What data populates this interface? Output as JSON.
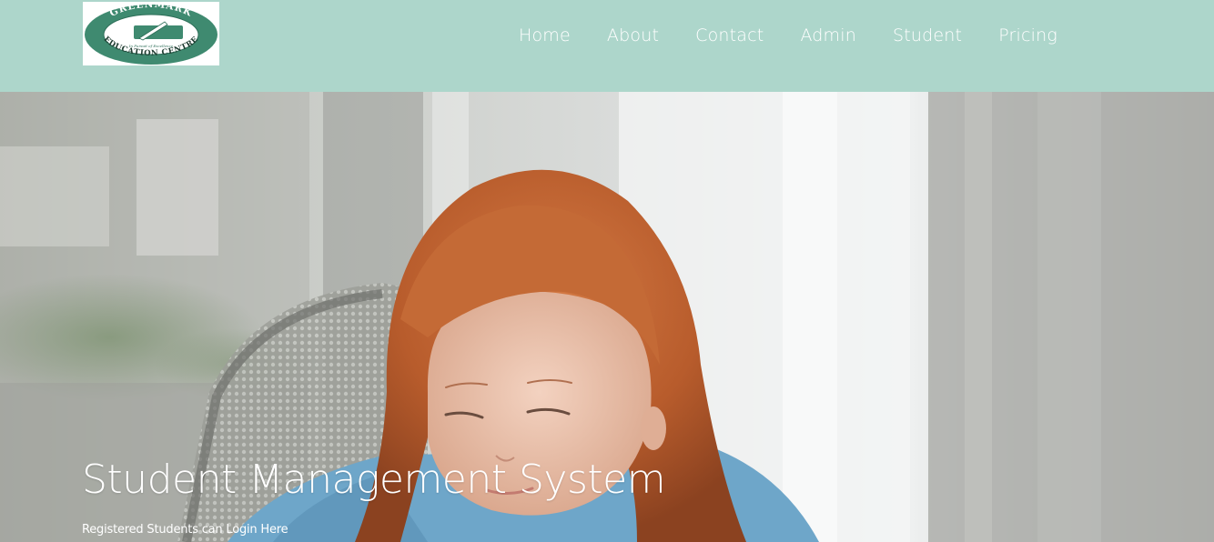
{
  "brand": {
    "logo_text_top": "GREENMARK",
    "logo_text_middle": "In Pursuit of Excellence",
    "logo_text_bottom": "EDUCATION CENTRE"
  },
  "nav": {
    "items": [
      {
        "label": "Home"
      },
      {
        "label": "About"
      },
      {
        "label": "Contact"
      },
      {
        "label": "Admin"
      },
      {
        "label": "Student"
      },
      {
        "label": "Pricing"
      }
    ]
  },
  "hero": {
    "title": "Student Management System",
    "subtitle": "Registered Students can Login Here"
  },
  "colors": {
    "navbar_bg": "#add6cb",
    "logo_green": "#3f8a70",
    "text": "#ffffff"
  }
}
